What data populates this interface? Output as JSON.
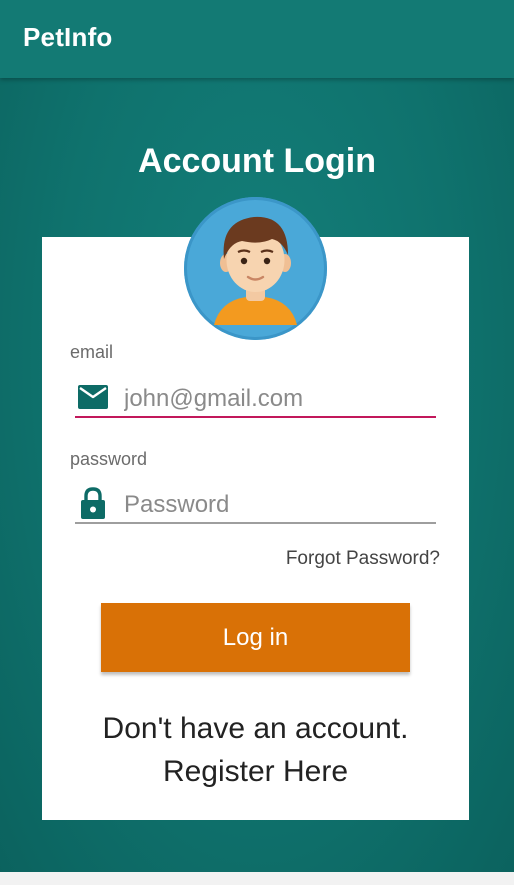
{
  "app_bar": {
    "title": "PetInfo"
  },
  "login": {
    "heading": "Account Login",
    "avatar_icon": "user-avatar-icon",
    "email": {
      "label": "email",
      "value": "",
      "placeholder": "john@gmail.com",
      "icon": "email-icon",
      "underline_color": "#c2185b"
    },
    "password": {
      "label": "password",
      "value": "",
      "placeholder": "Password",
      "icon": "lock-icon",
      "underline_color": "#9e9e9e"
    },
    "forgot_password": "Forgot Password?",
    "login_button": "Log in",
    "register_line1": "Don't have an account.",
    "register_line2": "Register Here"
  },
  "colors": {
    "primary": "#137a74",
    "accent": "#d97106",
    "icon": "#0d6b66"
  }
}
